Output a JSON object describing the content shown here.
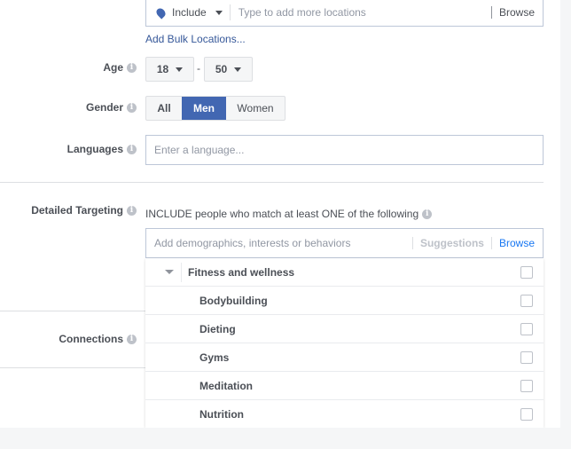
{
  "location": {
    "mode": "Include",
    "placeholder": "Type to add more locations",
    "browse": "Browse",
    "bulk_link": "Add Bulk Locations..."
  },
  "age": {
    "label": "Age",
    "min": "18",
    "separator": "-",
    "max": "50"
  },
  "gender": {
    "label": "Gender",
    "options": [
      "All",
      "Men",
      "Women"
    ],
    "selected": "Men"
  },
  "languages": {
    "label": "Languages",
    "placeholder": "Enter a language..."
  },
  "detailed": {
    "label": "Detailed Targeting",
    "include_text": "INCLUDE people who match at least ONE of the following",
    "placeholder": "Add demographics, interests or behaviors",
    "suggestions": "Suggestions",
    "browse": "Browse",
    "category": "Fitness and wellness",
    "items": [
      "Bodybuilding",
      "Dieting",
      "Gyms",
      "Meditation",
      "Nutrition"
    ]
  },
  "connections": {
    "label": "Connections"
  },
  "colors": {
    "accent": "#4267b2",
    "link": "#365899",
    "browse_active": "#1877f2"
  }
}
